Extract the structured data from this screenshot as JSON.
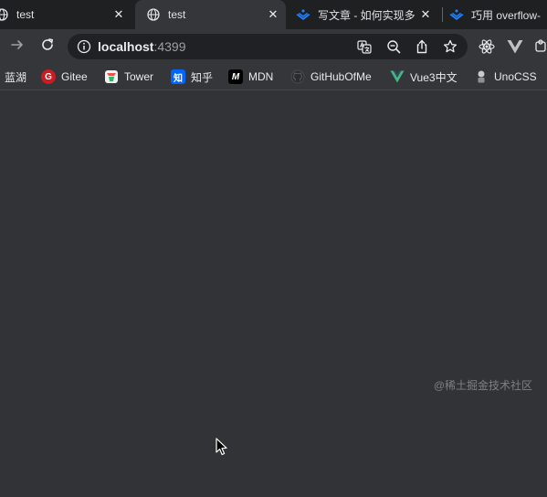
{
  "tabs": [
    {
      "title": "test",
      "icon": "globe-icon",
      "active": false
    },
    {
      "title": "test",
      "icon": "globe-icon",
      "active": true
    },
    {
      "title": "写文章 - 如何实现多",
      "icon": "juejin-icon",
      "active": false
    },
    {
      "title": "巧用 overflow-",
      "icon": "juejin-icon",
      "active": false
    }
  ],
  "tab_close_glyph": "✕",
  "address_bar": {
    "host": "localhost",
    "port": ":4399"
  },
  "bookmarks": [
    {
      "label": "蓝湖",
      "icon": "lanhu-icon"
    },
    {
      "label": "Gitee",
      "icon": "gitee-icon",
      "icon_text": "G",
      "color": "#c71d23"
    },
    {
      "label": "Tower",
      "icon": "tower-icon",
      "color": "#2fb66b"
    },
    {
      "label": "知乎",
      "icon": "zhihu-icon",
      "icon_text": "知",
      "color": "#0066ff"
    },
    {
      "label": "MDN",
      "icon": "mdn-icon",
      "icon_text": "M",
      "color": "#000000"
    },
    {
      "label": "GitHubOfMe",
      "icon": "github-icon"
    },
    {
      "label": "Vue3中文",
      "icon": "vue-icon",
      "color": "#42b883"
    },
    {
      "label": "UnoCSS",
      "icon": "unocss-icon"
    }
  ],
  "watermark": "@稀土掘金技术社区",
  "colors": {
    "tabstrip": "#1f2022",
    "toolbar": "#35363a",
    "content": "#323336",
    "accent_blue": "#1e80ff"
  }
}
